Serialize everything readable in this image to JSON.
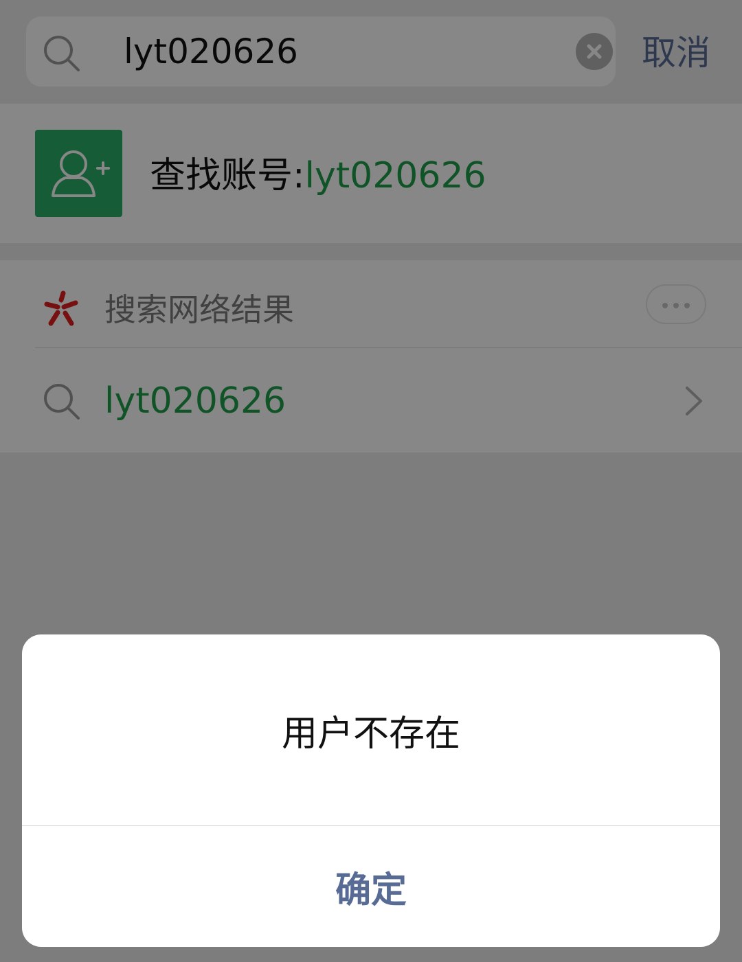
{
  "search": {
    "query": "lyt020626",
    "cancel_label": "取消"
  },
  "find_account": {
    "prefix": "查找账号:",
    "account": "lyt020626"
  },
  "web_results": {
    "title": "搜索网络结果",
    "query": "lyt020626"
  },
  "dialog": {
    "message": "用户不存在",
    "confirm_label": "确定"
  },
  "colors": {
    "accent_green": "#1e9e4a",
    "avatar_green": "#2aae67",
    "link_blue": "#576b95",
    "search_logo_red": "#e02020"
  },
  "icons": {
    "search": "search-icon",
    "clear": "clear-icon",
    "add_contact": "add-contact-icon",
    "web_search_logo": "web-search-logo-icon",
    "more": "more-icon",
    "chevron": "chevron-right-icon"
  }
}
